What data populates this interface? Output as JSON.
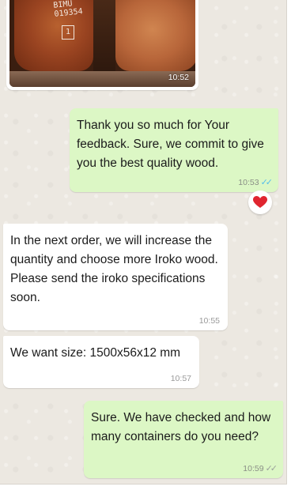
{
  "messages": [
    {
      "kind": "image",
      "direction": "incoming",
      "photo_text": "BIMU\n019354",
      "photo_box_text": "1",
      "time": "10:52"
    },
    {
      "kind": "text",
      "direction": "outgoing",
      "text": "Thank you so much for Your\nfeedback. Sure, we commit to give\nyou the best quality wood.",
      "time": "10:53",
      "status": "read",
      "reaction": "red-heart"
    },
    {
      "kind": "text",
      "direction": "incoming",
      "text": "In the next order, we will increase the\nquantity and choose more Iroko wood.\nPlease send the iroko specifications\nsoon.",
      "time": "10:55"
    },
    {
      "kind": "text",
      "direction": "incoming",
      "text": "We want size: 1500x56x12 mm",
      "time": "10:57"
    },
    {
      "kind": "text",
      "direction": "outgoing",
      "text": "Sure. We have checked and how\nmany containers do you need?",
      "time": "10:59",
      "status": "delivered"
    }
  ],
  "colors": {
    "chat_background": "#ece8e1",
    "outgoing_bubble": "#dcf7c5",
    "incoming_bubble": "#ffffff",
    "read_tick": "#53bdeb",
    "heart": "#e0252f"
  }
}
